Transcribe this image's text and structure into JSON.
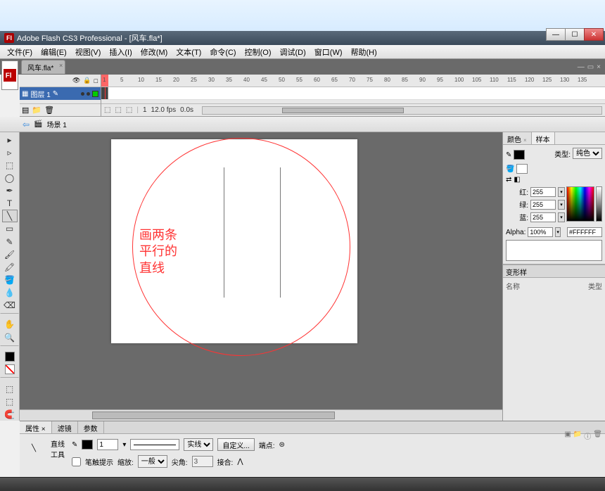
{
  "titlebar": {
    "app_name": "Adobe Flash CS3 Professional",
    "doc": "风车.fla*",
    "full": "Adobe Flash CS3 Professional - [风车.fla*]",
    "logo_letter": "Fl"
  },
  "menu": {
    "file": "文件(F)",
    "edit": "编辑(E)",
    "view": "视图(V)",
    "insert": "插入(I)",
    "modify": "修改(M)",
    "text": "文本(T)",
    "commands": "命令(C)",
    "control": "控制(O)",
    "debug": "调试(D)",
    "window": "窗口(W)",
    "help": "帮助(H)"
  },
  "doc_tab": "风车.fla*",
  "layers": {
    "name": "图层 1"
  },
  "timeline": {
    "frame": "1",
    "fps": "12.0 fps",
    "time": "0.0s",
    "ruler_marks": [
      1,
      5,
      10,
      15,
      20,
      25,
      30,
      35,
      40,
      45,
      50,
      55,
      60,
      65,
      70,
      75,
      80,
      85,
      90,
      95,
      100,
      105,
      110,
      115,
      120,
      125,
      130,
      135
    ]
  },
  "scene": {
    "label": "场景 1"
  },
  "annotation": {
    "line1": "画两条",
    "line2": "平行的",
    "line3": "直线"
  },
  "color_panel": {
    "tab_color": "颜色",
    "tab_swatches": "样本",
    "type_label": "类型:",
    "type_value": "纯色",
    "red_label": "红:",
    "red_value": "255",
    "green_label": "绿:",
    "green_value": "255",
    "blue_label": "蓝:",
    "blue_value": "255",
    "alpha_label": "Alpha:",
    "alpha_value": "100%",
    "hex": "#FFFFFF"
  },
  "middle_panel_label": "变形样",
  "lib": {
    "name_col": "名称",
    "type_col": "类型"
  },
  "properties": {
    "tab_props": "属性",
    "tab_filters": "滤镜",
    "tab_params": "参数",
    "tool_name": "直线",
    "tool_sub": "工具",
    "stroke_width": "1",
    "style": "实线",
    "custom_btn": "自定义...",
    "stroke_hint": "笔触提示",
    "scale_label": "缩放:",
    "scale_value": "一般",
    "cap_label": "端点:",
    "miter_label": "尖角:",
    "miter_value": "3",
    "join_label": "接合:"
  }
}
